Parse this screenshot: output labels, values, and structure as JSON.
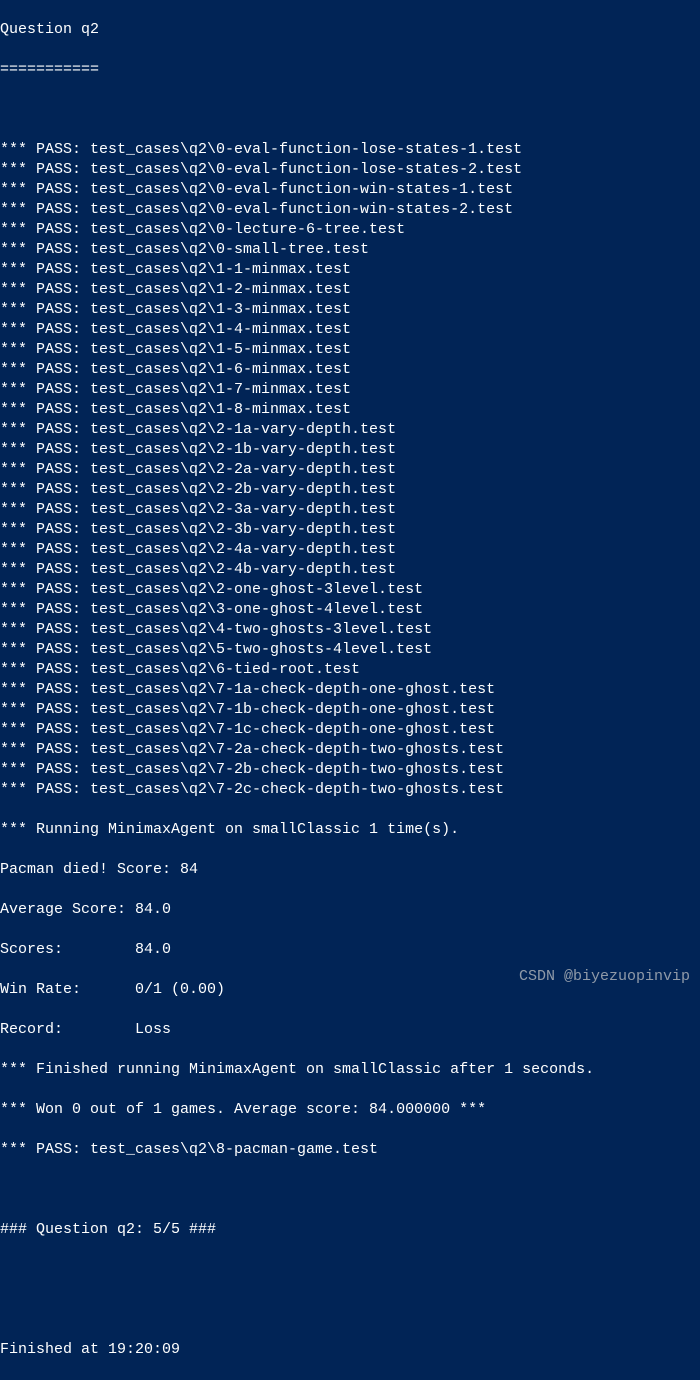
{
  "header": {
    "title": "Question q2",
    "separator": "==========="
  },
  "tests": [
    "*** PASS: test_cases\\q2\\0-eval-function-lose-states-1.test",
    "*** PASS: test_cases\\q2\\0-eval-function-lose-states-2.test",
    "*** PASS: test_cases\\q2\\0-eval-function-win-states-1.test",
    "*** PASS: test_cases\\q2\\0-eval-function-win-states-2.test",
    "*** PASS: test_cases\\q2\\0-lecture-6-tree.test",
    "*** PASS: test_cases\\q2\\0-small-tree.test",
    "*** PASS: test_cases\\q2\\1-1-minmax.test",
    "*** PASS: test_cases\\q2\\1-2-minmax.test",
    "*** PASS: test_cases\\q2\\1-3-minmax.test",
    "*** PASS: test_cases\\q2\\1-4-minmax.test",
    "*** PASS: test_cases\\q2\\1-5-minmax.test",
    "*** PASS: test_cases\\q2\\1-6-minmax.test",
    "*** PASS: test_cases\\q2\\1-7-minmax.test",
    "*** PASS: test_cases\\q2\\1-8-minmax.test",
    "*** PASS: test_cases\\q2\\2-1a-vary-depth.test",
    "*** PASS: test_cases\\q2\\2-1b-vary-depth.test",
    "*** PASS: test_cases\\q2\\2-2a-vary-depth.test",
    "*** PASS: test_cases\\q2\\2-2b-vary-depth.test",
    "*** PASS: test_cases\\q2\\2-3a-vary-depth.test",
    "*** PASS: test_cases\\q2\\2-3b-vary-depth.test",
    "*** PASS: test_cases\\q2\\2-4a-vary-depth.test",
    "*** PASS: test_cases\\q2\\2-4b-vary-depth.test",
    "*** PASS: test_cases\\q2\\2-one-ghost-3level.test",
    "*** PASS: test_cases\\q2\\3-one-ghost-4level.test",
    "*** PASS: test_cases\\q2\\4-two-ghosts-3level.test",
    "*** PASS: test_cases\\q2\\5-two-ghosts-4level.test",
    "*** PASS: test_cases\\q2\\6-tied-root.test",
    "*** PASS: test_cases\\q2\\7-1a-check-depth-one-ghost.test",
    "*** PASS: test_cases\\q2\\7-1b-check-depth-one-ghost.test",
    "*** PASS: test_cases\\q2\\7-1c-check-depth-one-ghost.test",
    "*** PASS: test_cases\\q2\\7-2a-check-depth-two-ghosts.test",
    "*** PASS: test_cases\\q2\\7-2b-check-depth-two-ghosts.test",
    "*** PASS: test_cases\\q2\\7-2c-check-depth-two-ghosts.test"
  ],
  "running": "*** Running MinimaxAgent on smallClassic 1 time(s).",
  "results": {
    "died": "Pacman died! Score: 84",
    "avg": "Average Score: 84.0",
    "scores": "Scores:        84.0",
    "winrate": "Win Rate:      0/1 (0.00)",
    "record": "Record:        Loss"
  },
  "finished_run": "*** Finished running MinimaxAgent on smallClassic after 1 seconds.",
  "won": "*** Won 0 out of 1 games. Average score: 84.000000 ***",
  "final_pass": "*** PASS: test_cases\\q2\\8-pacman-game.test",
  "summary": "### Question q2: 5/5 ###",
  "finished_at": "Finished at 19:20:09",
  "watermark": "CSDN @biyezuopinvip"
}
